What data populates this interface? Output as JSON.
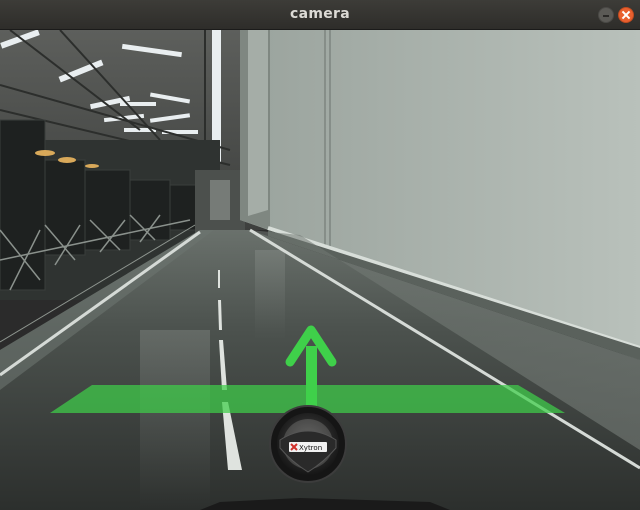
{
  "window": {
    "title": "camera"
  },
  "overlay": {
    "steering_brand": "Xytron",
    "direction": "straight"
  },
  "colors": {
    "guide_green": "#3fcf4a",
    "close_button": "#e9602f"
  },
  "icons": {
    "minimize": "minimize-icon",
    "close": "close-icon",
    "arrow": "up-arrow-icon",
    "wheel": "steering-wheel-icon"
  }
}
